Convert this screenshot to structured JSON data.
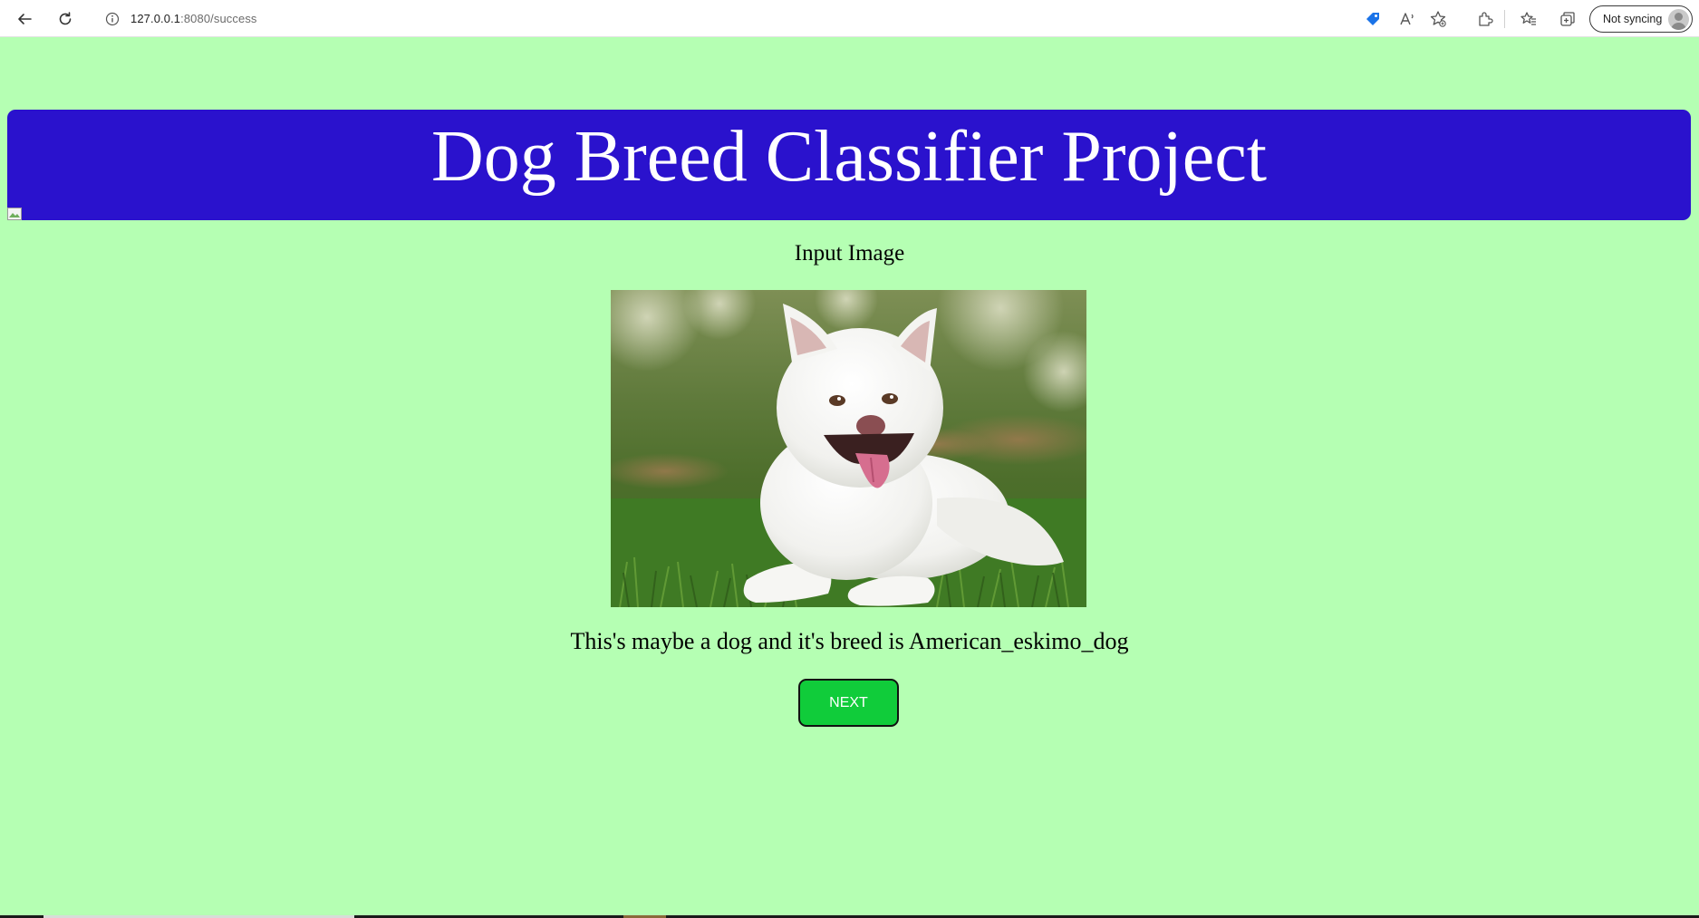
{
  "browser": {
    "url_host": "127.0.0.1",
    "url_path": ":8080/success",
    "profile_label": "Not syncing",
    "accent_color": "#1a73e8"
  },
  "page": {
    "title": "Dog Breed Classifier Project",
    "input_label": "Input Image",
    "result_text": "This's maybe a dog and it's breed is American_eskimo_dog",
    "next_label": "NEXT",
    "colors": {
      "background": "#b5ffb3",
      "banner": "#2a12cd",
      "button": "#10cc3a"
    }
  }
}
